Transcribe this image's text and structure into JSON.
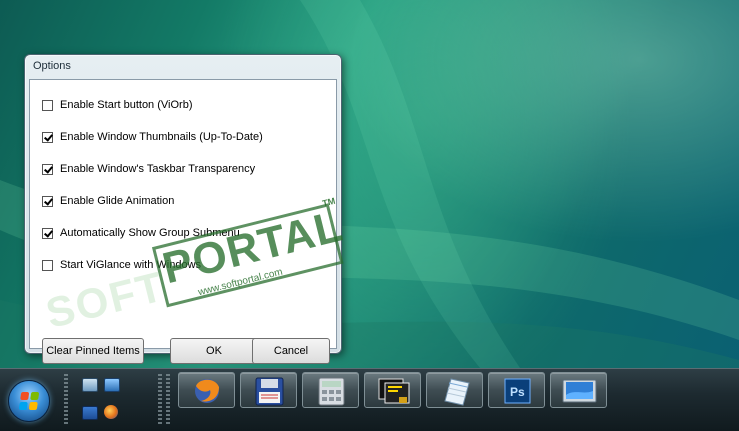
{
  "dialog": {
    "title": "Options",
    "options": [
      {
        "label": "Enable Start button (ViOrb)",
        "checked": false
      },
      {
        "label": "Enable Window Thumbnails (Up-To-Date)",
        "checked": true
      },
      {
        "label": "Enable Window's Taskbar Transparency",
        "checked": true
      },
      {
        "label": "Enable Glide Animation",
        "checked": true
      },
      {
        "label": "Automatically Show Group Submenu",
        "checked": true
      },
      {
        "label": "Start ViGlance with Windows",
        "checked": false
      }
    ],
    "buttons": {
      "clear": "Clear Pinned Items",
      "ok": "OK",
      "cancel": "Cancel"
    }
  },
  "watermark": {
    "brand": "PORTAL",
    "soft": "SOFT",
    "url": "www.softportal.com",
    "tm": "TM"
  },
  "taskbar": {
    "buttons": [
      {
        "icon": "firefox-icon"
      },
      {
        "icon": "floppy-disk-icon"
      },
      {
        "icon": "calculator-icon"
      },
      {
        "icon": "terminal-icon"
      },
      {
        "icon": "notepad-icon"
      },
      {
        "icon": "photoshop-icon",
        "label": "Ps"
      },
      {
        "icon": "monitor-icon"
      }
    ]
  }
}
